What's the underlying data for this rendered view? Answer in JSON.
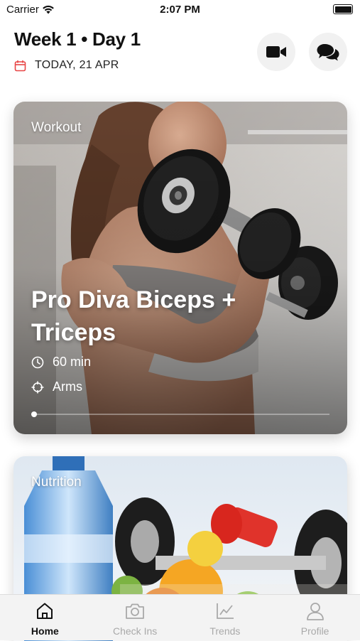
{
  "status_bar": {
    "carrier": "Carrier",
    "time": "2:07 PM"
  },
  "header": {
    "title": "Week 1 • Day 1",
    "date": "TODAY, 21 APR",
    "accent_color": "#e84545"
  },
  "cards": {
    "workout": {
      "tag": "Workout",
      "name": "Pro Diva Biceps + Triceps",
      "duration": "60 min",
      "area": "Arms",
      "progress": 0.0
    },
    "nutrition": {
      "tag": "Nutrition"
    }
  },
  "tabs": [
    {
      "label": "Home",
      "icon": "home-icon",
      "active": true
    },
    {
      "label": "Check Ins",
      "icon": "camera-icon",
      "active": false
    },
    {
      "label": "Trends",
      "icon": "chart-icon",
      "active": false
    },
    {
      "label": "Profile",
      "icon": "person-icon",
      "active": false
    }
  ]
}
